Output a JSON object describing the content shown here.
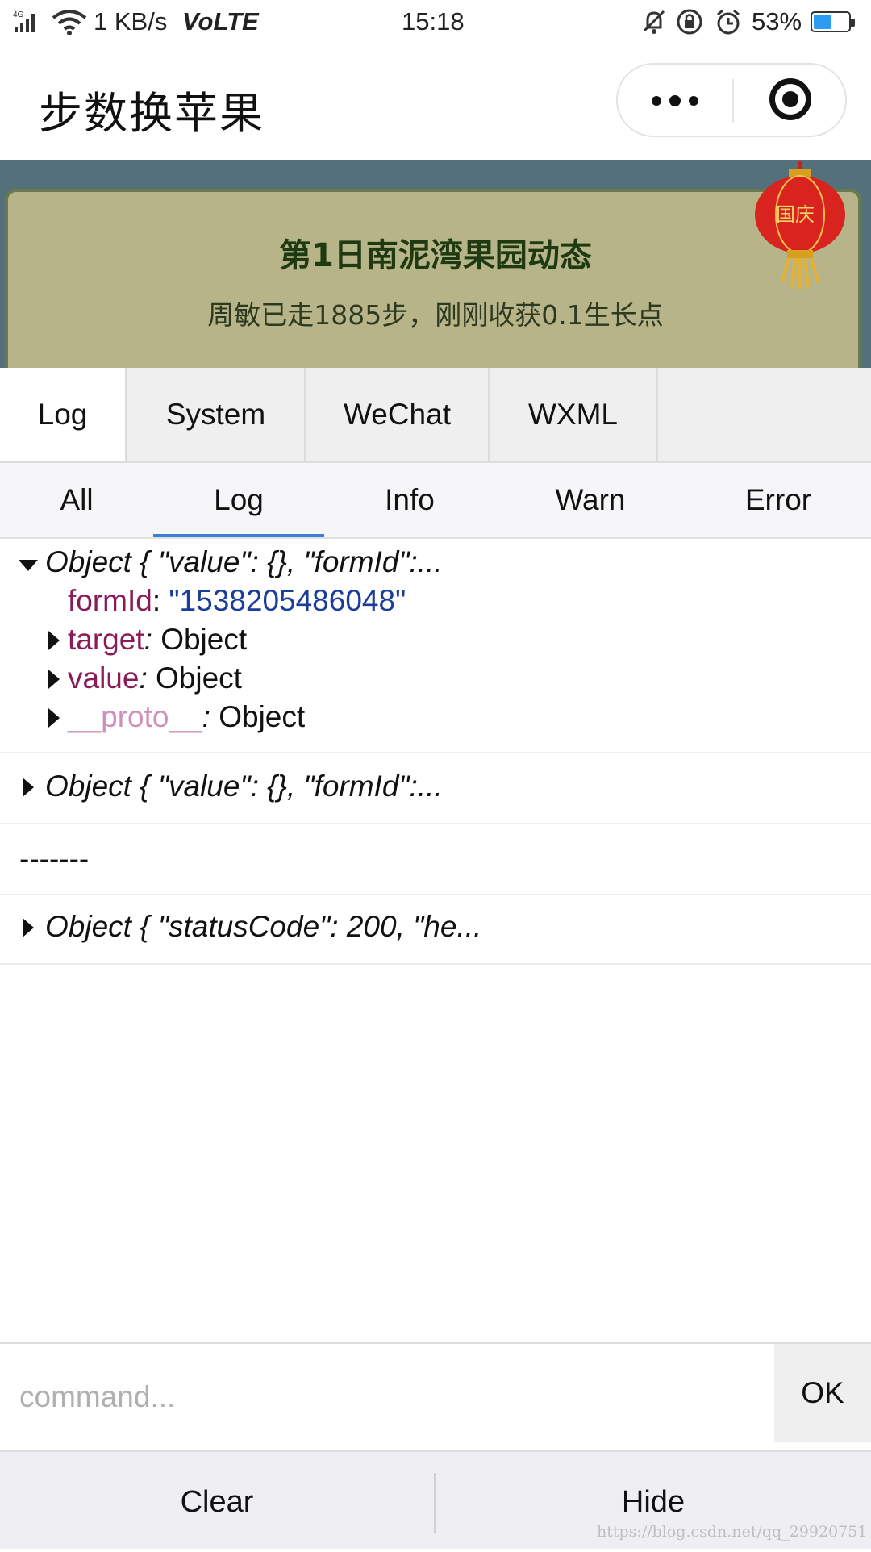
{
  "status_bar": {
    "network_type": "4G",
    "speed": "1 KB/s",
    "volte": "VoLTE",
    "time": "15:18",
    "battery_percent": "53%",
    "battery_level": 0.53,
    "icons": [
      "signal-icon",
      "wifi-icon",
      "silent-icon",
      "lock-rotation-icon",
      "alarm-icon",
      "battery-icon"
    ]
  },
  "header": {
    "title": "步数换苹果"
  },
  "banner": {
    "title": "第1日南泥湾果园动态",
    "subtitle": "周敏已走1885步，刚刚收获0.1生长点",
    "lantern_text": "国庆"
  },
  "main_tabs": [
    {
      "label": "Log",
      "active": true
    },
    {
      "label": "System",
      "active": false
    },
    {
      "label": "WeChat",
      "active": false
    },
    {
      "label": "WXML",
      "active": false
    }
  ],
  "sub_tabs": [
    {
      "label": "All",
      "active": false
    },
    {
      "label": "Log",
      "active": true
    },
    {
      "label": "Info",
      "active": false
    },
    {
      "label": "Warn",
      "active": false
    },
    {
      "label": "Error",
      "active": false
    }
  ],
  "console": {
    "entry1": {
      "summary": "Object { \"value\": {}, \"formId\":...",
      "formid_key": "formId",
      "formid_sep": ": ",
      "formid_value": "\"1538205486048\"",
      "target_key": "target",
      "target_value": "Object",
      "value_key": "value",
      "value_value": "Object",
      "proto_key": "__proto__",
      "proto_value": "Object",
      "colon": ":"
    },
    "entry2": {
      "summary": "Object { \"value\": {}, \"formId\":..."
    },
    "entry3": {
      "text": "-------"
    },
    "entry4": {
      "summary": "Object { \"statusCode\": 200, \"he..."
    }
  },
  "command": {
    "placeholder": "command...",
    "value": "",
    "ok_label": "OK"
  },
  "bottom": {
    "clear_label": "Clear",
    "hide_label": "Hide"
  },
  "watermark": "https://blog.csdn.net/qq_29920751",
  "colors": {
    "accent": "#3d80d8",
    "key": "#8a1a58",
    "string": "#1a3c9a",
    "battery": "#2b9cf2"
  }
}
